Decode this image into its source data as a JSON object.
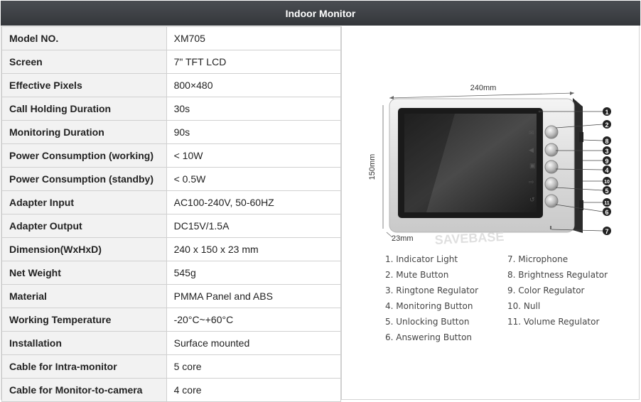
{
  "header": {
    "title": "Indoor Monitor"
  },
  "specs": [
    {
      "key": "Model NO.",
      "value": "XM705"
    },
    {
      "key": "Screen",
      "value": "7\" TFT LCD"
    },
    {
      "key": "Effective Pixels",
      "value": "800×480"
    },
    {
      "key": "Call Holding Duration",
      "value": "30s"
    },
    {
      "key": "Monitoring Duration",
      "value": "90s"
    },
    {
      "key": "Power Consumption (working)",
      "value": "< 10W"
    },
    {
      "key": "Power Consumption (standby)",
      "value": "< 0.5W"
    },
    {
      "key": "Adapter Input",
      "value": "AC100-240V, 50-60HZ"
    },
    {
      "key": "Adapter Output",
      "value": "DC15V/1.5A"
    },
    {
      "key": "Dimension(WxHxD)",
      "value": "240 x 150 x 23 mm"
    },
    {
      "key": "Net Weight",
      "value": "545g"
    },
    {
      "key": "Material",
      "value": "PMMA Panel and ABS"
    },
    {
      "key": "Working Temperature",
      "value": "-20°C~+60°C"
    },
    {
      "key": "Installation",
      "value": "Surface mounted"
    },
    {
      "key": "Cable for Intra-monitor",
      "value": "5 core"
    },
    {
      "key": "Cable for Monitor-to-camera",
      "value": "4 core"
    }
  ],
  "diagram": {
    "width_label": "240mm",
    "height_label": "150mm",
    "depth_label": "23mm",
    "watermark": "SAVEBASE",
    "callouts": [
      "1",
      "2",
      "8",
      "3",
      "9",
      "4",
      "10",
      "5",
      "11",
      "6",
      "7"
    ],
    "legend_left": [
      "1. Indicator Light",
      "2. Mute Button",
      "3. Ringtone Regulator",
      "4. Monitoring Button",
      "5. Unlocking Button",
      "6. Answering Button"
    ],
    "legend_right": [
      "7. Microphone",
      "8. Brightness Regulator",
      "9. Color Regulator",
      "10. Null",
      "11. Volume Regulator"
    ]
  }
}
